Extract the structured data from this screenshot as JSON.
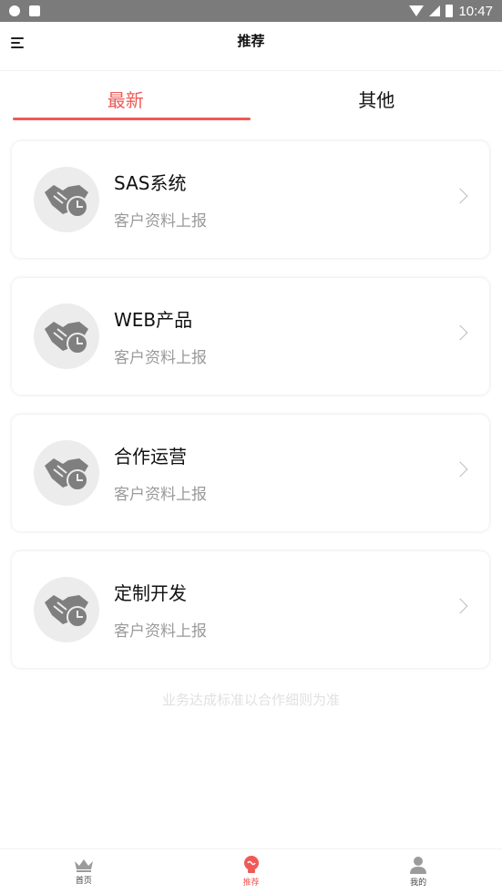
{
  "status_bar": {
    "time": "10:47",
    "left_icons": [
      "shield-icon",
      "a-icon"
    ],
    "right_icons": [
      "wifi-icon",
      "signal-icon",
      "battery-icon"
    ]
  },
  "app_bar": {
    "title": "推荐",
    "menu_icon": "menu-icon"
  },
  "tabs": [
    {
      "label": "最新",
      "active": true
    },
    {
      "label": "其他",
      "active": false
    }
  ],
  "accent_color": "#f05a56",
  "cards": [
    {
      "title": "SAS系统",
      "subtitle": "客户资料上报",
      "icon": "handshake-clock-icon"
    },
    {
      "title": "WEB产品",
      "subtitle": "客户资料上报",
      "icon": "handshake-clock-icon"
    },
    {
      "title": "合作运营",
      "subtitle": "客户资料上报",
      "icon": "handshake-clock-icon"
    },
    {
      "title": "定制开发",
      "subtitle": "客户资料上报",
      "icon": "handshake-clock-icon"
    }
  ],
  "footer_note": "业务达成标准以合作细则为准",
  "bottom_nav": [
    {
      "label": "首页",
      "icon": "crown-icon",
      "active": false
    },
    {
      "label": "推荐",
      "icon": "lightbulb-icon",
      "active": true
    },
    {
      "label": "我的",
      "icon": "person-icon",
      "active": false
    }
  ]
}
